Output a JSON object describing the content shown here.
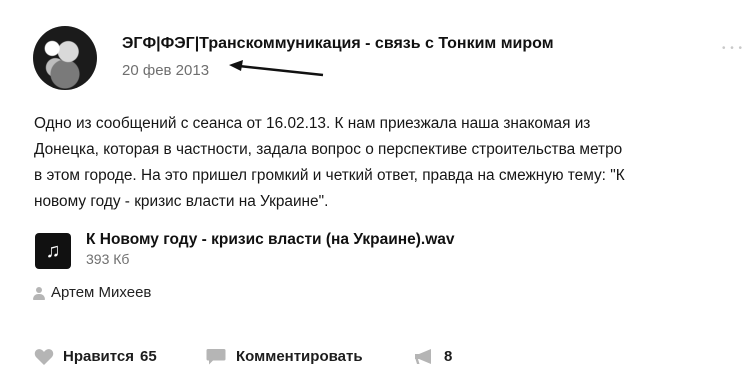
{
  "post": {
    "author": "ЭГФ|ФЭГ|Транскоммуникация - связь с Тонким миром",
    "date": "20 фев 2013",
    "text_lines": [
      "Одно из сообщений с сеанса от 16.02.13. К нам приезжала наша знакомая из",
      "Донецка, которая в частности, задала вопрос о перспективе строительства метро",
      "в этом городе. На это пришел громкий и четкий ответ, правда на смежную тему: \"К",
      "новому году - кризис власти на Украине\"."
    ],
    "attachment": {
      "icon": "music-note-icon",
      "title": "К Новому году - кризис власти (на Украине).wav",
      "size": "393 Кб"
    },
    "signer": "Артем Михеев"
  },
  "actions": {
    "like_label": "Нравится",
    "like_count": "65",
    "comment_label": "Комментировать",
    "share_count": "8"
  },
  "colors": {
    "text": "#161616",
    "muted": "#6f6f6f",
    "icon_gray": "#b5b5b5",
    "audio_icon_bg": "#111111"
  }
}
